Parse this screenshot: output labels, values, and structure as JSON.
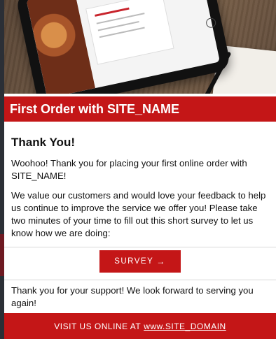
{
  "email": {
    "title": "First Order with SITE_NAME",
    "heading": "Thank You!",
    "para1": "Woohoo! Thank you for placing your first online order with SITE_NAME!",
    "para2": "We value our customers and would love your feedback to help us continue to improve the service we offer you! Please take two minutes of your time to fill out this short survey to let us know how we are doing:",
    "survey_button": "SURVEY",
    "survey_arrow": "→",
    "closing": "Thank you for your support! We look forward to serving you again!",
    "footer_prefix": "VISIT US ONLINE AT",
    "footer_link": "www.SITE_DOMAIN"
  },
  "colors": {
    "accent": "#c41617",
    "background": "#2b2f36"
  },
  "icons": {
    "arrow": "arrow-right-icon"
  }
}
